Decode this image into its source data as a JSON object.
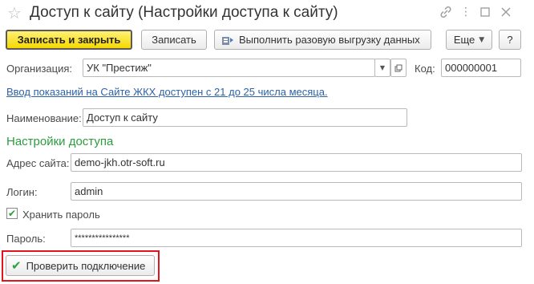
{
  "window": {
    "title": "Доступ к сайту (Настройки доступа к сайту)",
    "icons": {
      "favorite": "star-icon",
      "link": "link-icon",
      "more": "more-vertical-icon",
      "maximize": "maximize-icon",
      "close": "close-icon"
    }
  },
  "toolbar": {
    "save_close": "Записать и закрыть",
    "save": "Записать",
    "export": "Выполнить разовую выгрузку данных",
    "more": "Еще",
    "help": "?"
  },
  "form": {
    "org_label": "Организация:",
    "org_value": "УК \"Престиж\"",
    "code_label": "Код:",
    "code_value": "000000001",
    "info_link": "Ввод показаний на Сайте ЖКХ доступен с 21 до 25 числа месяца.",
    "name_label": "Наименование:",
    "name_value": "Доступ к сайту",
    "section_title": "Настройки доступа",
    "site_label": "Адрес сайта:",
    "site_value": "demo-jkh.otr-soft.ru",
    "login_label": "Логин:",
    "login_value": "admin",
    "store_password_label": "Хранить пароль",
    "store_password_checked": true,
    "password_label": "Пароль:",
    "password_value": "****************",
    "check_button": "Проверить подключение"
  },
  "colors": {
    "primary_button": "#f5d800",
    "section_title": "#2a9d3c",
    "link": "#2d62a8",
    "highlight": "#e0161c"
  }
}
